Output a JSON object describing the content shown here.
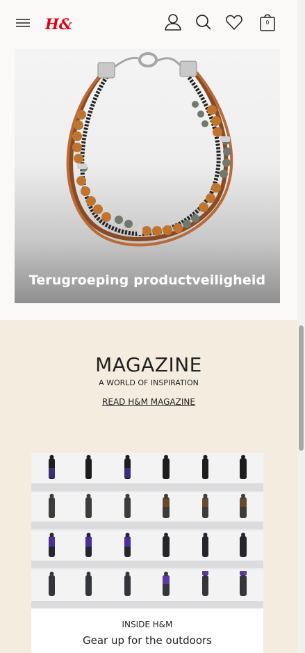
{
  "header": {
    "logo_text": "H&M",
    "icons": [
      "menu-icon",
      "account-icon",
      "search-icon",
      "favorites-icon",
      "shopping-bag-icon"
    ],
    "bag_count": "0",
    "brand_color": "#e50010"
  },
  "hero": {
    "title": "Terugroeping productveiligheid"
  },
  "magazine": {
    "title": "MAGAZINE",
    "subtitle": "A WORLD OF INSPIRATION",
    "link_label": "READ H&M MAGAZINE",
    "background_color": "#f4ecdf",
    "card": {
      "kicker": "INSIDE H&M",
      "title": "Gear up for the outdoors"
    }
  }
}
